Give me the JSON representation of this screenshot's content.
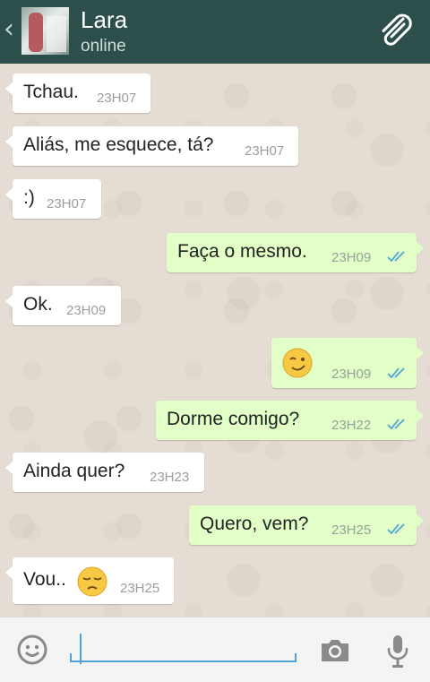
{
  "header": {
    "back_glyph": "‹",
    "contact_name": "Lara",
    "status": "online",
    "bg_color": "#2d4f4b"
  },
  "messages": [
    {
      "side": "in",
      "text": "Tchau.",
      "time": "23H07"
    },
    {
      "side": "in",
      "text": "Aliás, me esquece, tá?",
      "time": "23H07"
    },
    {
      "side": "in",
      "text": ":)",
      "time": "23H07"
    },
    {
      "side": "out",
      "text": "Faça o mesmo.",
      "time": "23H09",
      "read": true
    },
    {
      "side": "in",
      "text": "Ok.",
      "time": "23H09"
    },
    {
      "side": "out",
      "text": "",
      "emoji": "winking-face",
      "time": "23H09",
      "read": true
    },
    {
      "side": "out",
      "text": "Dorme comigo?",
      "time": "23H22",
      "read": true
    },
    {
      "side": "in",
      "text": "Ainda quer?",
      "time": "23H23"
    },
    {
      "side": "out",
      "text": "Quero, vem?",
      "time": "23H25",
      "read": true
    },
    {
      "side": "in",
      "text": "Vou..",
      "emoji": "pensive-face",
      "time": "23H25"
    }
  ],
  "composer": {
    "placeholder": "",
    "accent": "#4fa3d8"
  },
  "colors": {
    "chat_bg": "#e5ddd3",
    "incoming": "#ffffff",
    "outgoing": "#e1ffc7",
    "read_ticks": "#4fa3d8"
  }
}
